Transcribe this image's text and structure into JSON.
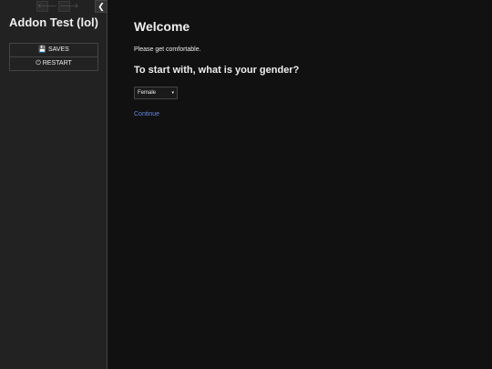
{
  "sidebar": {
    "history_back_icon": "arrow-left-icon",
    "history_forward_icon": "arrow-right-icon",
    "toggle_icon": "chevron-left-icon",
    "history_back_glyph": "🡐",
    "history_forward_glyph": "🡒",
    "toggle_glyph": "❮",
    "story_title": "Addon Test (lol)",
    "menu": [
      {
        "label": "SAVES",
        "icon": "floppy-disk-icon",
        "glyph": "💾"
      },
      {
        "label": "RESTART",
        "icon": "power-icon",
        "glyph": "⏻"
      }
    ]
  },
  "passage": {
    "title": "Welcome",
    "text": "Please get comfortable.",
    "question": "To start with, what is your gender?",
    "gender_select": {
      "selected": "Female",
      "arrow_glyph": "▾"
    },
    "continue_label": "Continue"
  },
  "colors": {
    "background": "#111111",
    "sidebar": "#222222",
    "link": "#6688dd"
  }
}
